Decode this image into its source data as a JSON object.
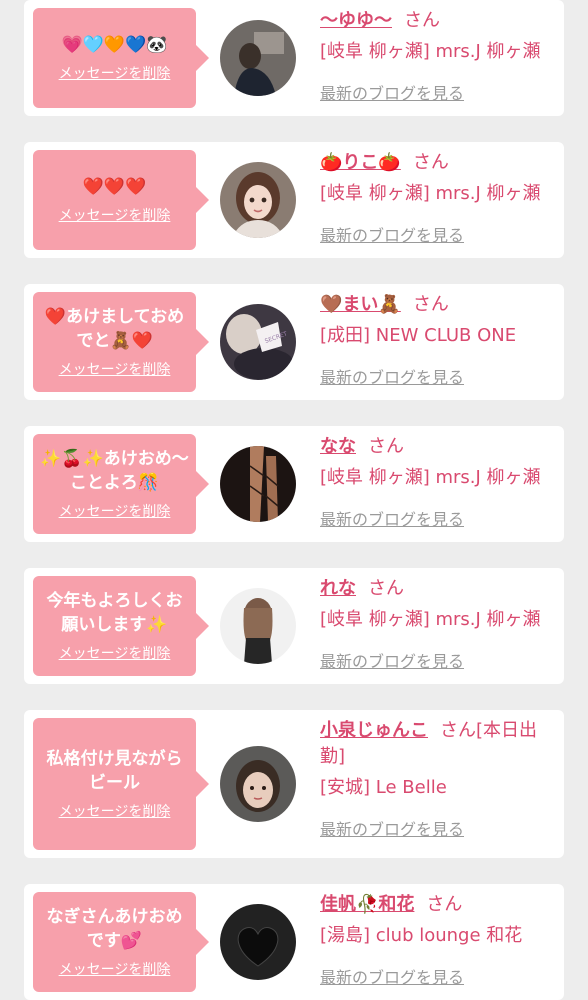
{
  "entries": [
    {
      "message": "💗🩵🧡💙🐼",
      "delete_label": "メッセージを削除",
      "name": "〜ゆゆ〜",
      "honorific": "さん",
      "note": "",
      "shop": "[岐阜 柳ヶ瀬] mrs.J 柳ヶ瀬",
      "blog_label": "最新のブログを見る"
    },
    {
      "message": "❤️❤️❤️",
      "delete_label": "メッセージを削除",
      "name": "🍅りこ🍅",
      "honorific": "さん",
      "note": "",
      "shop": "[岐阜 柳ヶ瀬] mrs.J 柳ヶ瀬",
      "blog_label": "最新のブログを見る"
    },
    {
      "message": "❤️あけましておめでと🧸❤️",
      "delete_label": "メッセージを削除",
      "name": "🤎まい🧸",
      "honorific": "さん",
      "note": "",
      "shop": "[成田] NEW CLUB ONE",
      "blog_label": "最新のブログを見る"
    },
    {
      "message": "✨🍒✨あけおめ〜ことよろ🎊",
      "delete_label": "メッセージを削除",
      "name": "なな",
      "honorific": "さん",
      "note": "",
      "shop": "[岐阜 柳ヶ瀬] mrs.J 柳ヶ瀬",
      "blog_label": "最新のブログを見る"
    },
    {
      "message": "今年もよろしくお願いします✨",
      "delete_label": "メッセージを削除",
      "name": "れな",
      "honorific": "さん",
      "note": "",
      "shop": "[岐阜 柳ヶ瀬] mrs.J 柳ヶ瀬",
      "blog_label": "最新のブログを見る"
    },
    {
      "message": "私格付け見ながらビール",
      "delete_label": "メッセージを削除",
      "name": "小泉じゅんこ",
      "honorific": "さん",
      "note": "[本日出勤]",
      "shop": "[安城] Le Belle",
      "blog_label": "最新のブログを見る"
    },
    {
      "message": "なぎさんあけおめです💕",
      "delete_label": "メッセージを削除",
      "name": "佳帆🥀和花",
      "honorific": "さん",
      "note": "",
      "shop": "[湯島] club lounge 和花",
      "blog_label": "最新のブログを見る"
    }
  ],
  "colors": {
    "page_bg": "#ededed",
    "bubble": "#f7a0ab",
    "accent": "#d94a6f",
    "link_gray": "#9a9a9a"
  }
}
